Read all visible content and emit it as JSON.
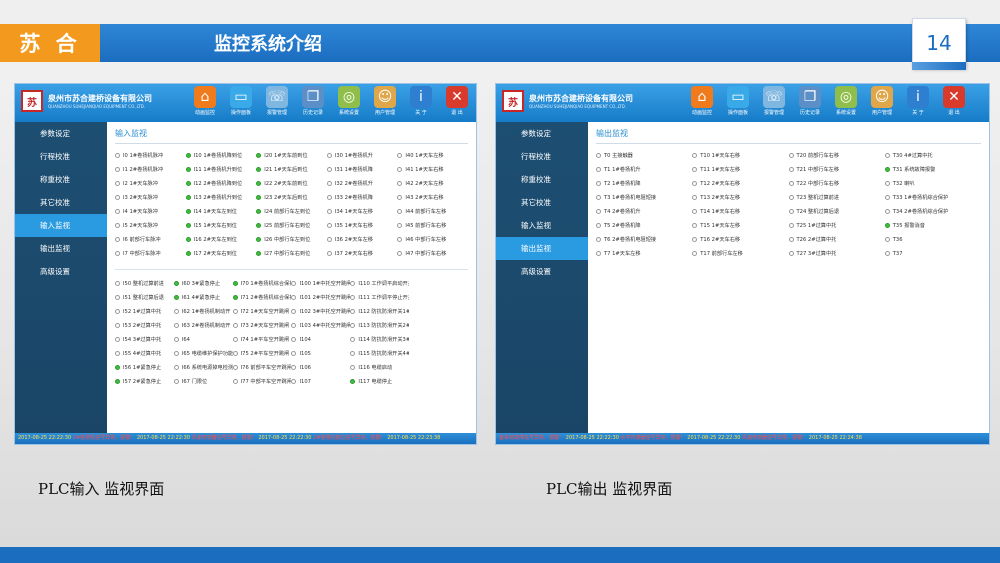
{
  "slide": {
    "brand": "苏 合",
    "title": "监控系统介绍",
    "page_number": "14",
    "colors": {
      "header": "#1b6dc0",
      "brand_box": "#f39a1e",
      "panel_active": "#2a9be0"
    }
  },
  "captions": {
    "left": "PLC输入 监视界面",
    "right": "PLC输出 监视界面"
  },
  "app": {
    "company_cn": "泉州市苏合建桥设备有限公司",
    "company_en": "QUANZHOU SUHEJIANQIAO EQUIPMENT CO.,LTD.",
    "toolbar": [
      {
        "label": "动画监控",
        "icon": "home-icon"
      },
      {
        "label": "操作面板",
        "icon": "monitor-icon"
      },
      {
        "label": "报警管理",
        "icon": "alarm-icon"
      },
      {
        "label": "历史记录",
        "icon": "history-icon"
      },
      {
        "label": "系统设置",
        "icon": "settings-icon"
      },
      {
        "label": "用户管理",
        "icon": "user-icon"
      },
      {
        "label": "关 于",
        "icon": "info-icon"
      },
      {
        "label": "退 出",
        "icon": "exit-icon"
      }
    ]
  },
  "input_screen": {
    "sidebar": [
      "参数设定",
      "行程校准",
      "称重校准",
      "其它校准",
      "输入监视",
      "输出监视",
      "高级设置"
    ],
    "active_index": 4,
    "section_title": "输入监视",
    "group1": [
      {
        "t": "I0 1#卷扬机脉冲",
        "on": false
      },
      {
        "t": "I10 1#卷扬机降到位",
        "on": true
      },
      {
        "t": "I20 1#天车前到位",
        "on": true
      },
      {
        "t": "I30 1#卷扬机升",
        "on": false
      },
      {
        "t": "I40 1#天车左移",
        "on": false
      },
      {
        "t": "I1 2#卷扬机脉冲",
        "on": false
      },
      {
        "t": "I11 1#卷扬机升到位",
        "on": true
      },
      {
        "t": "I21 1#天车后到位",
        "on": true
      },
      {
        "t": "I31 1#卷扬机降",
        "on": false
      },
      {
        "t": "I41 1#天车右移",
        "on": false
      },
      {
        "t": "I2 1#天车脉冲",
        "on": false
      },
      {
        "t": "I12 2#卷扬机降到位",
        "on": true
      },
      {
        "t": "I22 2#天车前到位",
        "on": true
      },
      {
        "t": "I32 2#卷扬机升",
        "on": false
      },
      {
        "t": "I42 2#天车左移",
        "on": false
      },
      {
        "t": "I3 2#天车脉冲",
        "on": false
      },
      {
        "t": "I13 2#卷扬机升到位",
        "on": true
      },
      {
        "t": "I23 2#天车后到位",
        "on": true
      },
      {
        "t": "I33 2#卷扬机降",
        "on": false
      },
      {
        "t": "I43 2#天车右移",
        "on": false
      },
      {
        "t": "I4 1#天车脉冲",
        "on": false
      },
      {
        "t": "I14 1#天车左到位",
        "on": true
      },
      {
        "t": "I24 前部行车左到位",
        "on": true
      },
      {
        "t": "I34 1#天车左移",
        "on": false
      },
      {
        "t": "I44 前部行车左移",
        "on": false
      },
      {
        "t": "I5 2#天车脉冲",
        "on": false
      },
      {
        "t": "I15 1#天车右到位",
        "on": true
      },
      {
        "t": "I25 前部行车右到位",
        "on": true
      },
      {
        "t": "I35 1#天车右移",
        "on": false
      },
      {
        "t": "I45 前部行车右移",
        "on": false
      },
      {
        "t": "I6 前部行车脉冲",
        "on": false
      },
      {
        "t": "I16 2#天车左到位",
        "on": true
      },
      {
        "t": "I26 中部行车左到位",
        "on": true
      },
      {
        "t": "I36 2#天车左移",
        "on": false
      },
      {
        "t": "I46 中部行车左移",
        "on": false
      },
      {
        "t": "I7 中部行车脉冲",
        "on": false
      },
      {
        "t": "I17 2#天车右到位",
        "on": true
      },
      {
        "t": "I27 中部行车右到位",
        "on": true
      },
      {
        "t": "I37 2#天车右移",
        "on": false
      },
      {
        "t": "I47 中部行车右移",
        "on": false
      }
    ],
    "group2": [
      {
        "t": "I50 整机过算前进",
        "on": false
      },
      {
        "t": "I60 3#紧急停止",
        "on": true
      },
      {
        "t": "I70 1#卷扬机综合保护器",
        "on": true
      },
      {
        "t": "I100 1#中托空开跳闸",
        "on": false
      },
      {
        "t": "I110 工作调平启动开关",
        "on": false
      },
      {
        "t": "",
        "on": false
      },
      {
        "t": "I51 整机过算后退",
        "on": false
      },
      {
        "t": "I61 4#紧急停止",
        "on": true
      },
      {
        "t": "I71 2#卷扬机综合保护器",
        "on": true
      },
      {
        "t": "I101 2#中托空开跳闸",
        "on": false
      },
      {
        "t": "I111 工作调平停止开关",
        "on": false
      },
      {
        "t": "",
        "on": false
      },
      {
        "t": "I52 1#过算中托",
        "on": false
      },
      {
        "t": "I62 1#卷扬机制动开",
        "on": false
      },
      {
        "t": "I72 1#天车空开跳闸",
        "on": false
      },
      {
        "t": "I102 3#中托空开跳闸",
        "on": false
      },
      {
        "t": "I112 防抗防滑开关1#",
        "on": false
      },
      {
        "t": "",
        "on": false
      },
      {
        "t": "I53 2#过算中托",
        "on": false
      },
      {
        "t": "I63 2#卷扬机制动开",
        "on": false
      },
      {
        "t": "I73 2#天车空开跳闸",
        "on": false
      },
      {
        "t": "I103 4#中托空开跳闸",
        "on": false
      },
      {
        "t": "I113 防抗防滑开关2#",
        "on": false
      },
      {
        "t": "",
        "on": false
      },
      {
        "t": "I54 3#过算中托",
        "on": false
      },
      {
        "t": "I64",
        "on": false
      },
      {
        "t": "I74 1#平车空开跳闸",
        "on": false
      },
      {
        "t": "I104",
        "on": false
      },
      {
        "t": "I114 防抗防滑开关3#",
        "on": false
      },
      {
        "t": "",
        "on": false
      },
      {
        "t": "I55 4#过算中托",
        "on": false
      },
      {
        "t": "I65 电缆维护保护功能",
        "on": false
      },
      {
        "t": "I75 2#平车空开跳闸",
        "on": false
      },
      {
        "t": "I105",
        "on": false
      },
      {
        "t": "I115 防抗防滑开关4#",
        "on": false
      },
      {
        "t": "",
        "on": false
      },
      {
        "t": "I56 1#紧急停止",
        "on": true
      },
      {
        "t": "I66 系统电源掉电检测",
        "on": false
      },
      {
        "t": "I76 前部平车空开跳闸",
        "on": false
      },
      {
        "t": "I106",
        "on": false
      },
      {
        "t": "I116 电缆启动",
        "on": false
      },
      {
        "t": "",
        "on": false
      },
      {
        "t": "I57 2#紧急停止",
        "on": true
      },
      {
        "t": "I67 门限位",
        "on": false
      },
      {
        "t": "I77 中部平车空开跳闸",
        "on": false
      },
      {
        "t": "I107",
        "on": false
      },
      {
        "t": "I117 电缆停止",
        "on": true
      },
      {
        "t": "",
        "on": false
      }
    ],
    "status_bar": [
      {
        "time": "2017-08-25 22:22:30",
        "msg": "1#卷扬机信号异常，报警!"
      },
      {
        "time": "2017-08-25 22:22:30",
        "msg": "风速传感器信号异常，报警!"
      },
      {
        "time": "2017-08-25 22:22:30",
        "msg": "2#卷扬机复位信号异常，报警!"
      },
      {
        "time": "2017-08-25 22:23:38",
        "msg": ""
      }
    ]
  },
  "output_screen": {
    "sidebar": [
      "参数设定",
      "行程校准",
      "称重校准",
      "其它校准",
      "输入监视",
      "输出监视",
      "高级设置"
    ],
    "active_index": 5,
    "section_title": "输出监视",
    "group1": [
      {
        "t": "T0 主接触器",
        "on": false
      },
      {
        "t": "T10 1#天车右移",
        "on": false
      },
      {
        "t": "T20 前部行车右移",
        "on": false
      },
      {
        "t": "T30 4#过算中托",
        "on": false
      },
      {
        "t": "T1 1#卷扬机升",
        "on": false
      },
      {
        "t": "T11 1#天车左移",
        "on": false
      },
      {
        "t": "T21 中部行车左移",
        "on": false
      },
      {
        "t": "T31 系统故障报警",
        "on": true
      },
      {
        "t": "T2 1#卷扬机降",
        "on": false
      },
      {
        "t": "T12 2#天车右移",
        "on": false
      },
      {
        "t": "T22 中部行车右移",
        "on": false
      },
      {
        "t": "T32 喇叭",
        "on": false
      },
      {
        "t": "T3 1#卷扬机电阻短接",
        "on": false
      },
      {
        "t": "T13 2#天车左移",
        "on": false
      },
      {
        "t": "T23 整机过算前进",
        "on": false
      },
      {
        "t": "T33 1#卷扬机综合保护",
        "on": false
      },
      {
        "t": "T4 2#卷扬机升",
        "on": false
      },
      {
        "t": "T14 1#天车右移",
        "on": false
      },
      {
        "t": "T24 整机过算后退",
        "on": false
      },
      {
        "t": "T34 2#卷扬机综合保护",
        "on": false
      },
      {
        "t": "T5 2#卷扬机降",
        "on": false
      },
      {
        "t": "T15 1#天车左移",
        "on": false
      },
      {
        "t": "T25 1#过算中托",
        "on": false
      },
      {
        "t": "T35 报警消音",
        "on": true
      },
      {
        "t": "T6 2#卷扬机电阻短接",
        "on": false
      },
      {
        "t": "T16 2#天车右移",
        "on": false
      },
      {
        "t": "T26 2#过算中托",
        "on": false
      },
      {
        "t": "T36",
        "on": false
      },
      {
        "t": "T7 1#天车左移",
        "on": false
      },
      {
        "t": "T17 前部行车左移",
        "on": false
      },
      {
        "t": "T27 3#过算中托",
        "on": false
      },
      {
        "t": "T37",
        "on": false
      }
    ],
    "status_bar": [
      {
        "time": "",
        "msg": "备系统故障信号异常，报警!"
      },
      {
        "time": "2017-08-25 22:22:30",
        "msg": "水平传感器信号异常，报警!"
      },
      {
        "time": "2017-08-25 22:22:30",
        "msg": "风速传感器信号异常，报警!"
      },
      {
        "time": "2017-08-25 22:24:38",
        "msg": ""
      }
    ]
  }
}
